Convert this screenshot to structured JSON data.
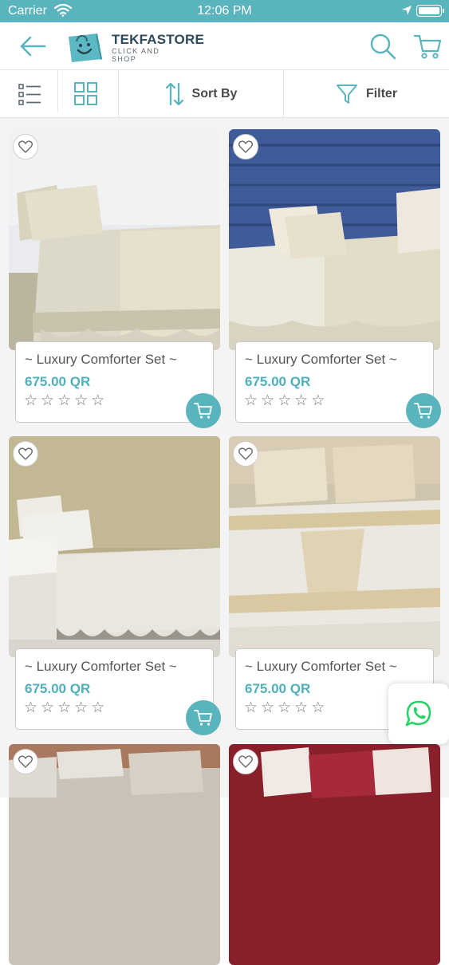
{
  "status_bar": {
    "carrier": "Carrier",
    "time": "12:06 PM"
  },
  "header": {
    "brand": "TEKFASTORE",
    "tagline": "CLICK AND SHOP"
  },
  "toolbar": {
    "sort_label": "Sort By",
    "filter_label": "Filter"
  },
  "colors": {
    "accent": "#5ab4bd",
    "price": "#4fb0bb",
    "whatsapp": "#25d366"
  },
  "products": [
    {
      "title": "~ Luxury Comforter Set ~",
      "price": "675.00 QR",
      "rating": 0
    },
    {
      "title": "~ Luxury Comforter Set ~",
      "price": "675.00 QR",
      "rating": 0
    },
    {
      "title": "~ Luxury Comforter Set ~",
      "price": "675.00 QR",
      "rating": 0
    },
    {
      "title": "~ Luxury Comforter Set ~",
      "price": "675.00 QR",
      "rating": 0
    }
  ],
  "icons": [
    "back-arrow-icon",
    "search-icon",
    "cart-icon",
    "list-view-icon",
    "grid-view-icon",
    "sort-icon",
    "filter-icon",
    "heart-icon",
    "star-icon",
    "add-to-cart-icon",
    "whatsapp-icon"
  ]
}
